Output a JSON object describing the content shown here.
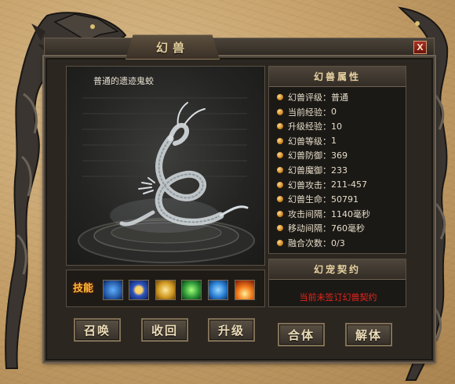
{
  "window": {
    "title": "幻兽",
    "close_glyph": "X"
  },
  "model": {
    "name": "普通的遗迹鬼蛟"
  },
  "skills": {
    "label": "技能",
    "slots": [
      {
        "icon": "blue-beast-skill-icon",
        "color": "#2a6fb8"
      },
      {
        "icon": "blue-gold-armor-skill-icon",
        "color": "#2f56c4"
      },
      {
        "icon": "golden-shield-skill-icon",
        "color": "#c9921c"
      },
      {
        "icon": "green-poison-skill-icon",
        "color": "#2f9a3a"
      },
      {
        "icon": "blue-wave-skill-icon",
        "color": "#2a7fd4"
      },
      {
        "icon": "fire-skill-icon",
        "color": "#d8481a"
      }
    ]
  },
  "buttons": {
    "summon": "召唤",
    "recall": "收回",
    "upgrade": "升级",
    "merge": "合体",
    "dismiss": "解体"
  },
  "attributes": {
    "header": "幻兽属性",
    "rows": [
      {
        "label": "幻兽评级：",
        "value": "普通"
      },
      {
        "label": "当前经验：",
        "value": "0"
      },
      {
        "label": "升级经验：",
        "value": "10"
      },
      {
        "label": "幻兽等级：",
        "value": "1"
      },
      {
        "label": "幻兽防御：",
        "value": "369"
      },
      {
        "label": "幻兽魔御：",
        "value": "233"
      },
      {
        "label": "幻兽攻击：",
        "value": "211-457"
      },
      {
        "label": "幻兽生命：",
        "value": "50791"
      },
      {
        "label": "攻击间隔：",
        "value": "1140毫秒"
      },
      {
        "label": "移动间隔：",
        "value": "760毫秒"
      },
      {
        "label": "融合次数：",
        "value": "0/3"
      }
    ]
  },
  "contract": {
    "header": "幻宠契约",
    "status": "当前未签订幻兽契约"
  },
  "colors": {
    "accent_gold": "#e8d2a0",
    "warning_red": "#e8241a"
  }
}
